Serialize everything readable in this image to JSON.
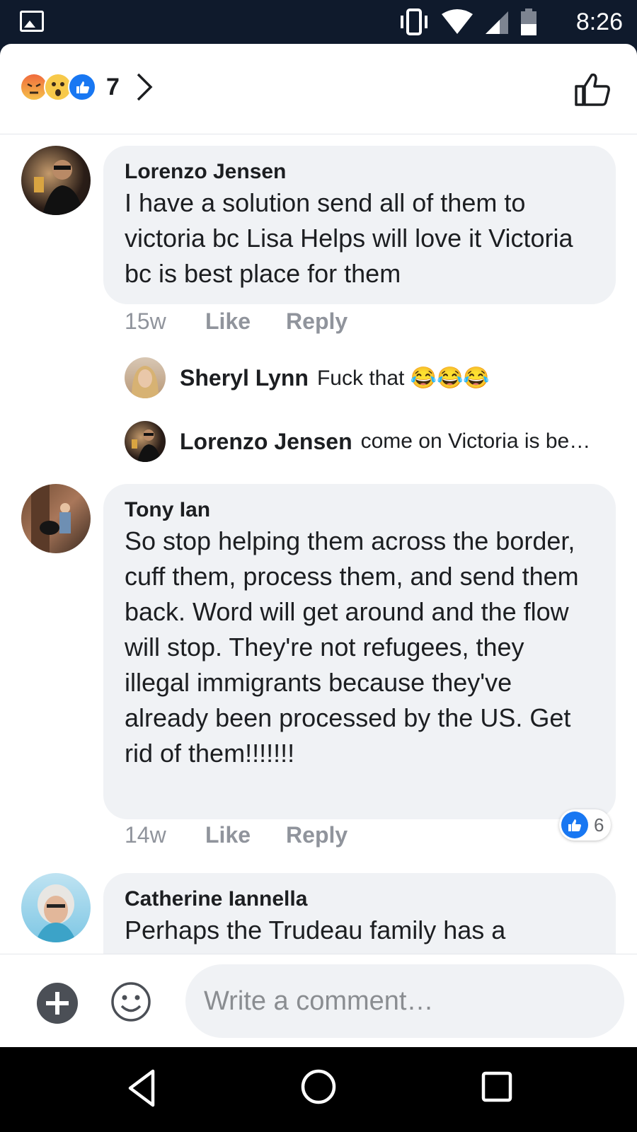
{
  "status_bar": {
    "time": "8:26",
    "icons": [
      "gallery-icon",
      "vibrate-icon",
      "wifi-icon",
      "signal-icon",
      "battery-icon"
    ]
  },
  "reactions": {
    "types": [
      "angry",
      "wow",
      "like"
    ],
    "count": "7"
  },
  "comments": [
    {
      "author": "Lorenzo Jensen",
      "text": "I have a solution send all of them to victoria bc Lisa Helps will love it Victoria bc is best place for them",
      "time": "15w",
      "like_label": "Like",
      "reply_label": "Reply",
      "replies": [
        {
          "author": "Sheryl Lynn",
          "text": "Fuck that 😂😂😂"
        },
        {
          "author": "Lorenzo Jensen",
          "text": "come on Victoria is be…"
        }
      ]
    },
    {
      "author": "Tony Ian",
      "text": "So stop helping them across the border, cuff them, process them, and send them back. Word will get around and the flow will stop. They're not refugees, they illegal immigrants because they've already been processed by the US. Get rid of them!!!!!!!",
      "time": "14w",
      "like_label": "Like",
      "reply_label": "Reply",
      "like_count": "6"
    },
    {
      "author": "Catherine Iannella",
      "text": "Perhaps the Trudeau family has a"
    }
  ],
  "composer": {
    "placeholder": "Write a comment…"
  },
  "colors": {
    "status_bar_bg": "#0f1a2c",
    "bubble_bg": "#f0f2f5",
    "like_blue": "#1877f2",
    "meta_gray": "#90949c"
  }
}
